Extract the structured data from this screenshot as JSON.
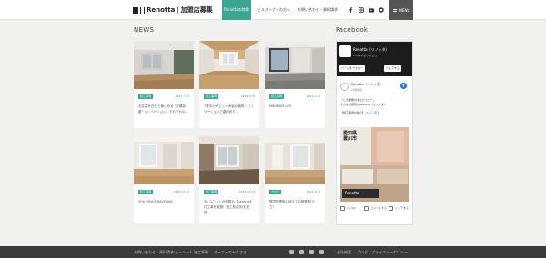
{
  "header": {
    "logo": "Renotta",
    "logo_sep": "|",
    "logo_sub": "加盟店募集",
    "nav": [
      {
        "label": "Renottaの特徴"
      },
      {
        "label": "ビルオーナーの方へ"
      },
      {
        "label": "お問い合わせ・資料請求"
      }
    ],
    "menu_label": "MENU",
    "icons": [
      "facebook-icon",
      "instagram-icon",
      "youtube-icon",
      "line-icon"
    ]
  },
  "news": {
    "title": "NEWS",
    "cards": [
      {
        "tag": "施工事例",
        "date": "2024.7.15",
        "title": "天井高を存分で愉しめる \"空調部屋\" リノベーション。それぞれの..."
      },
      {
        "tag": "施工事例",
        "date": "2024.5.29",
        "title": "7畳半のがビュー木製の植物・リノベーションで劇的彩り..."
      },
      {
        "tag": "施工事例",
        "date": "2024.2.21",
        "title": "MINIMUM LIFE"
      },
      {
        "tag": "施工事例",
        "date": "2023.12.18",
        "title": "YOU WHILE RAVEYAN!"
      },
      {
        "tag": "施工事例",
        "date": "2023.09.12",
        "title": "3R ユニットの部屋の【Lazarus】付工事を実施！施工前/初月を初新..."
      },
      {
        "tag": "ブログ",
        "date": "2023.9.23",
        "title": "環境修理時に使えての雑物 防止力！"
      }
    ]
  },
  "facebook": {
    "title": "Facebook",
    "page_name": "Renotta（リノッタ）",
    "followers": "2,579人のフォロワー",
    "follow_label": "ページをフォロー",
    "share_label": "シェアする",
    "post_name": "Renotta（リノッタ）",
    "post_time": "12時間前",
    "post_lines": [
      "「この部屋のまんだった？」",
      "そんなお部屋はRenotta（リノッタ）",
      "【施工事例の紹介】"
    ],
    "more_label": "もっと見る",
    "image_caption_1": "愛知県",
    "image_caption_2": "豊川市",
    "image_logo": "Renotta",
    "actions": [
      "いいね！",
      "コメントする",
      "シェアする"
    ]
  },
  "footer": {
    "links": [
      "お問い合わせ・資料請求",
      "ショールーム",
      "施工事例",
      "オーナーのみなさま"
    ],
    "right_links": [
      "会社概要",
      "ブログ",
      "プライバシーポリシー"
    ],
    "icons": [
      "facebook-icon",
      "instagram-icon",
      "youtube-icon",
      "line-icon"
    ]
  }
}
